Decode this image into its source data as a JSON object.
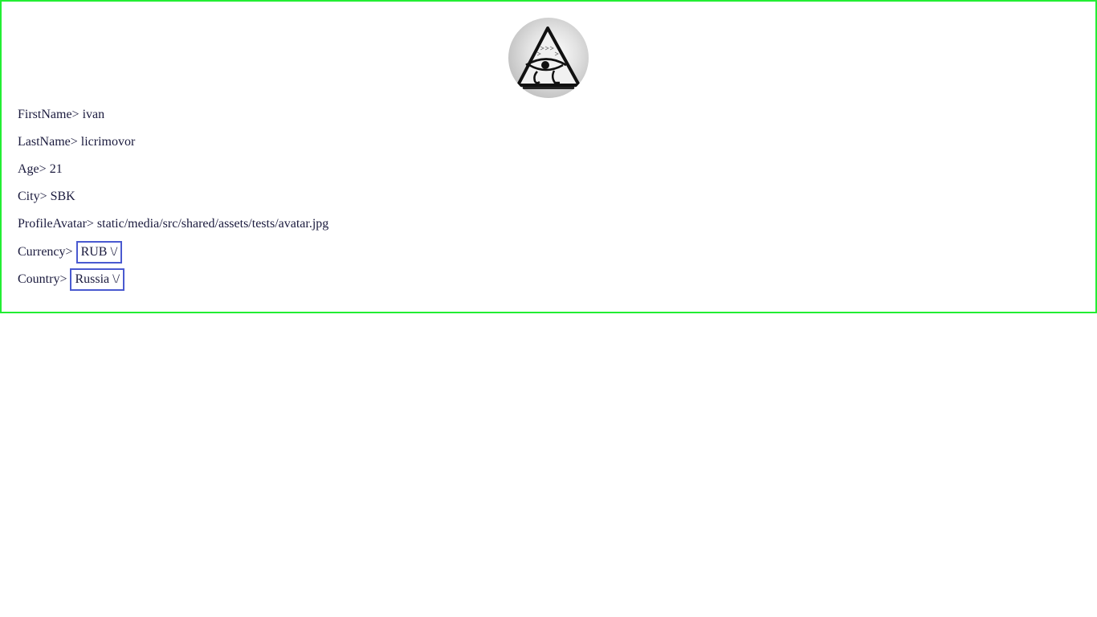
{
  "profile": {
    "first_name": {
      "label": "FirstName>",
      "value": "ivan"
    },
    "last_name": {
      "label": "LastName>",
      "value": "licrimovor"
    },
    "age": {
      "label": "Age>",
      "value": "21"
    },
    "city": {
      "label": "City>",
      "value": "SBK"
    },
    "avatar_path": {
      "label": "ProfileAvatar>",
      "value": "static/media/src/shared/assets/tests/avatar.jpg"
    },
    "currency": {
      "label": "Currency>",
      "selected": "RUB",
      "arrow": "\\/"
    },
    "country": {
      "label": "Country>",
      "selected": "Russia",
      "arrow": "\\/"
    }
  },
  "avatar": {
    "icon": "eye-of-providence-icon"
  },
  "colors": {
    "card_border": "#22ee33",
    "select_border": "#4a5ad0",
    "text": "#1a1a3d"
  }
}
